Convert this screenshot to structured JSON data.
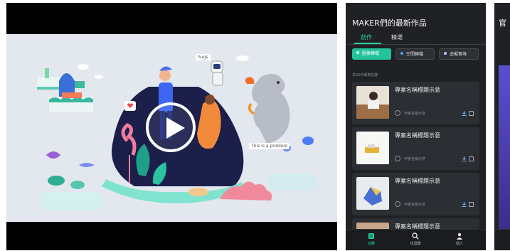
{
  "video": {
    "scene_label_1": "hugs",
    "scene_label_2": "This is a problem"
  },
  "phone": {
    "title": "MAKER們的最新作品",
    "tabs": [
      {
        "label": "創作",
        "active": true
      },
      {
        "label": "精選",
        "active": false
      }
    ],
    "chips": [
      {
        "label": "圖像轉檔",
        "icon": "image-icon"
      },
      {
        "label": "空間轉檔",
        "icon": "space-icon"
      },
      {
        "label": "虛擬實境",
        "icon": "vr-icon"
      }
    ],
    "count_text": "共20件專案紀錄",
    "cards": [
      {
        "title": "專案名稱標題示意",
        "author": "作者名稱示意"
      },
      {
        "title": "專案名稱標題示意",
        "author": "作者名稱示意"
      },
      {
        "title": "專案名稱標題示意",
        "author": "作者名稱示意"
      },
      {
        "title": "專案名稱標題示意"
      }
    ],
    "nav": [
      {
        "label": "前瞻",
        "icon": "home-icon",
        "active": true
      },
      {
        "label": "找尋器",
        "icon": "search-icon",
        "active": false
      },
      {
        "label": "個人",
        "icon": "profile-icon",
        "active": false
      }
    ]
  },
  "peek": {
    "title": "官"
  },
  "colors": {
    "accent": "#24d0a0",
    "panel": "#1f2124",
    "card": "#2b2e33"
  }
}
